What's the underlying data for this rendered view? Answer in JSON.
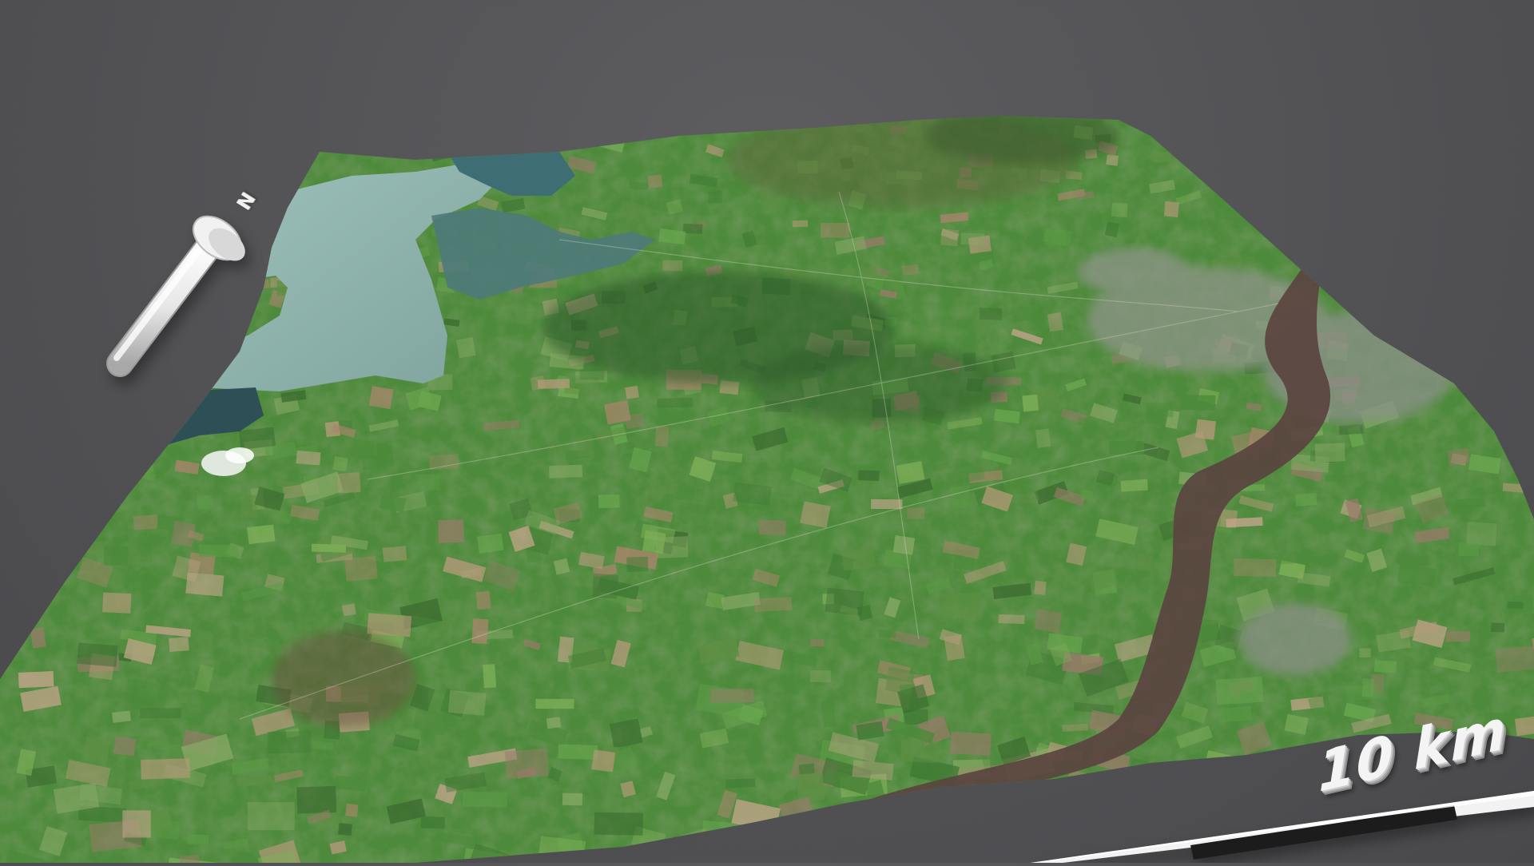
{
  "map": {
    "scale_bar_label": "10 km",
    "north_label": "N",
    "colors": {
      "background": "#545457",
      "field_green": "#4f8a3c",
      "dark_green": "#2f5a2c",
      "lough_water": "#8fb3ad",
      "deep_water": "#3f5d66",
      "river": "#5a4440",
      "urban": "#8e9488",
      "scale_white": "#f2f2f2",
      "scale_black": "#1e1e1e"
    }
  }
}
